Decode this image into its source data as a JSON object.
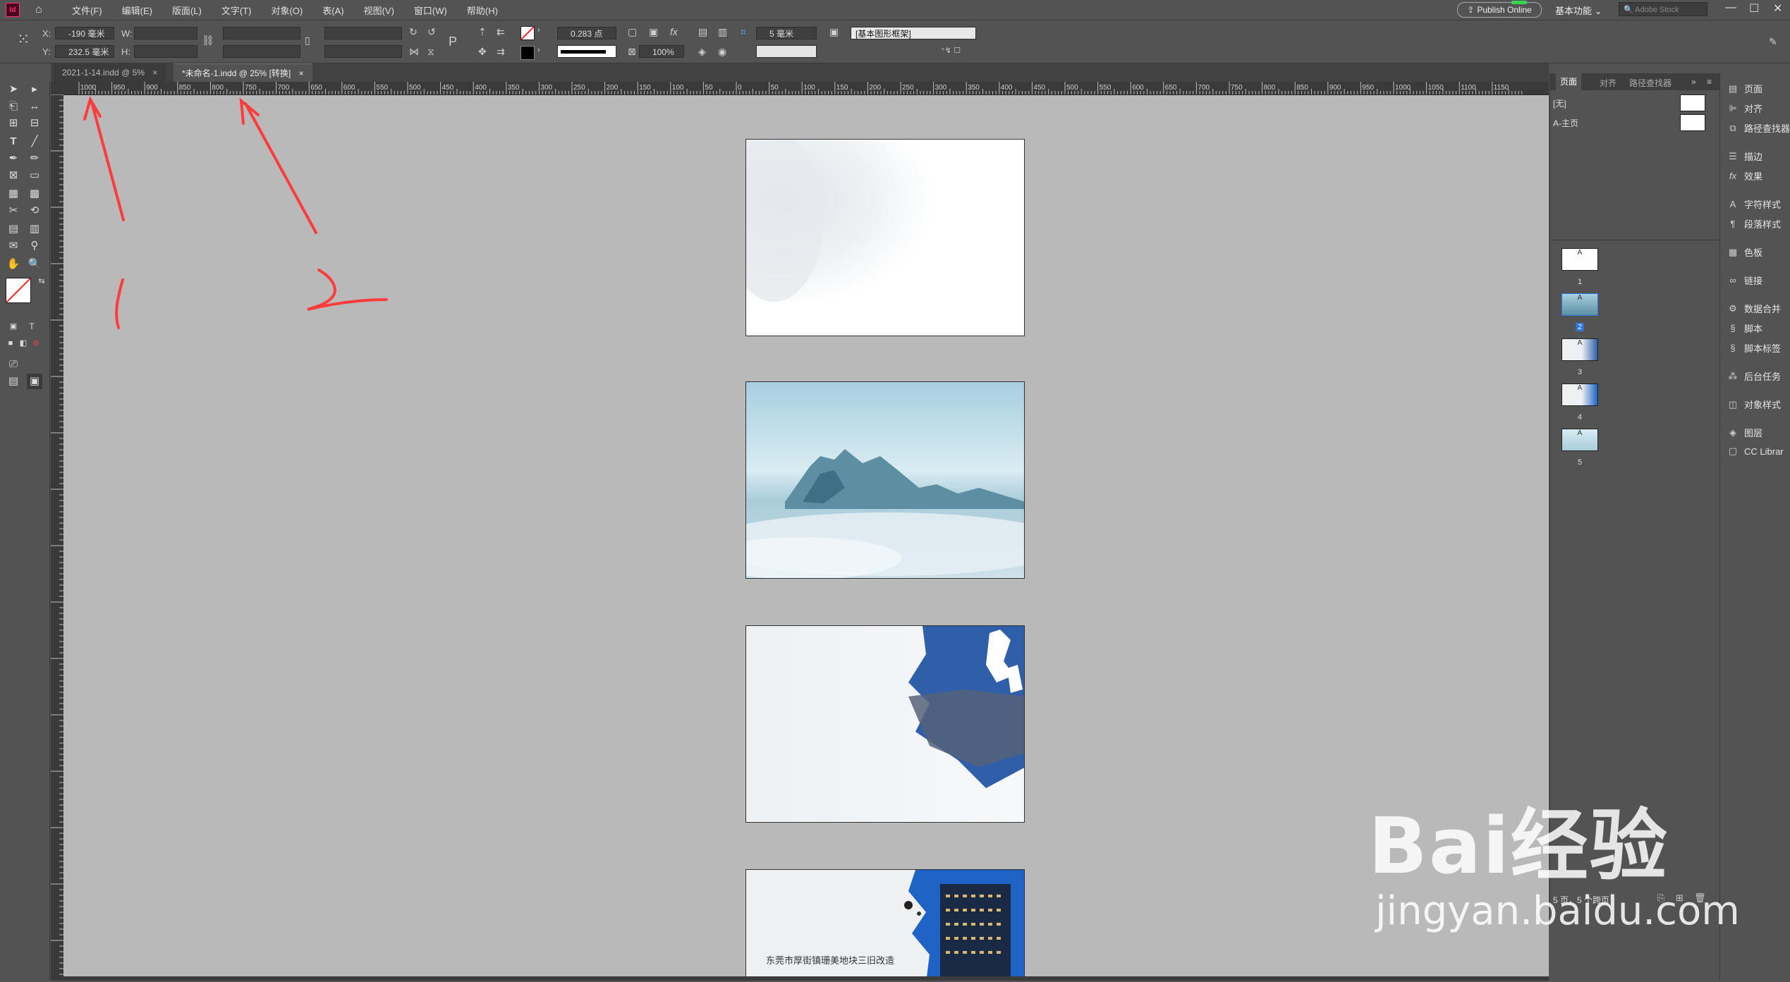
{
  "menu": {
    "items": [
      "文件(F)",
      "编辑(E)",
      "版面(L)",
      "文字(T)",
      "对象(O)",
      "表(A)",
      "视图(V)",
      "窗口(W)",
      "帮助(H)"
    ],
    "publish_label": "Publish Online",
    "workspace_label": "基本功能",
    "stock_placeholder": "Adobe Stock"
  },
  "control": {
    "x_label": "X:",
    "y_label": "Y:",
    "w_label": "W:",
    "h_label": "H:",
    "x_value": "-190 毫米",
    "y_value": "232.5 毫米",
    "stroke_weight": "0.283 点",
    "opacity": "100%",
    "corner": "5 毫米",
    "frame_style": "[基本图形框架]"
  },
  "tabs": [
    {
      "label": "2021-1-14.indd @ 5%",
      "close": "×"
    },
    {
      "label": "*未命名-1.indd @ 25% [转换]",
      "close": "×"
    }
  ],
  "ruler": {
    "labels": [
      "1000",
      "950",
      "900",
      "850",
      "800",
      "750",
      "700",
      "650",
      "600",
      "550",
      "500",
      "450",
      "400",
      "350",
      "300",
      "250",
      "200",
      "150",
      "100",
      "50",
      "0",
      "50",
      "100",
      "150",
      "200",
      "250",
      "300",
      "350",
      "400",
      "450",
      "500",
      "550",
      "600",
      "650",
      "700",
      "750",
      "800",
      "850",
      "900",
      "950",
      "1000",
      "1050",
      "1100",
      "1150"
    ]
  },
  "document": {
    "page4_caption": "东莞市厚街镇珊美地块三旧改造"
  },
  "pages_panel": {
    "tabs": [
      "页面",
      "对齐",
      "路径查找器"
    ],
    "master_none": "[无]",
    "master_a": "A-主页",
    "thumbs": [
      {
        "num": "1",
        "master": "A"
      },
      {
        "num": "2",
        "master": "A"
      },
      {
        "num": "3",
        "master": "A"
      },
      {
        "num": "4",
        "master": "A"
      },
      {
        "num": "5",
        "master": "A"
      }
    ],
    "footer": "5 页，5 个跨页"
  },
  "side_panels": [
    {
      "label": "页面",
      "icon": "pages-icon"
    },
    {
      "label": "对齐",
      "icon": "align-icon"
    },
    {
      "label": "路径查找器",
      "icon": "pathfinder-icon"
    },
    {
      "label": "描边",
      "icon": "stroke-icon"
    },
    {
      "label": "效果",
      "icon": "effects-icon"
    },
    {
      "label": "字符样式",
      "icon": "character-styles-icon"
    },
    {
      "label": "段落样式",
      "icon": "paragraph-styles-icon"
    },
    {
      "label": "色板",
      "icon": "swatches-icon"
    },
    {
      "label": "链接",
      "icon": "links-icon"
    },
    {
      "label": "数据合并",
      "icon": "data-merge-icon"
    },
    {
      "label": "脚本",
      "icon": "scripts-icon"
    },
    {
      "label": "脚本标签",
      "icon": "script-label-icon"
    },
    {
      "label": "后台任务",
      "icon": "background-tasks-icon"
    },
    {
      "label": "对象样式",
      "icon": "object-styles-icon"
    },
    {
      "label": "图层",
      "icon": "layers-icon"
    },
    {
      "label": "CC Librar",
      "icon": "cc-libraries-icon"
    }
  ],
  "annotations": {
    "mark1": "1",
    "mark2": "2"
  },
  "watermark": {
    "brand": "Bai经验",
    "site": "jingyan.baidu.com"
  },
  "colors": {
    "accent": "#ff3b3b",
    "app_bg": "#535353",
    "canvas_bg": "#b9b9b9"
  }
}
